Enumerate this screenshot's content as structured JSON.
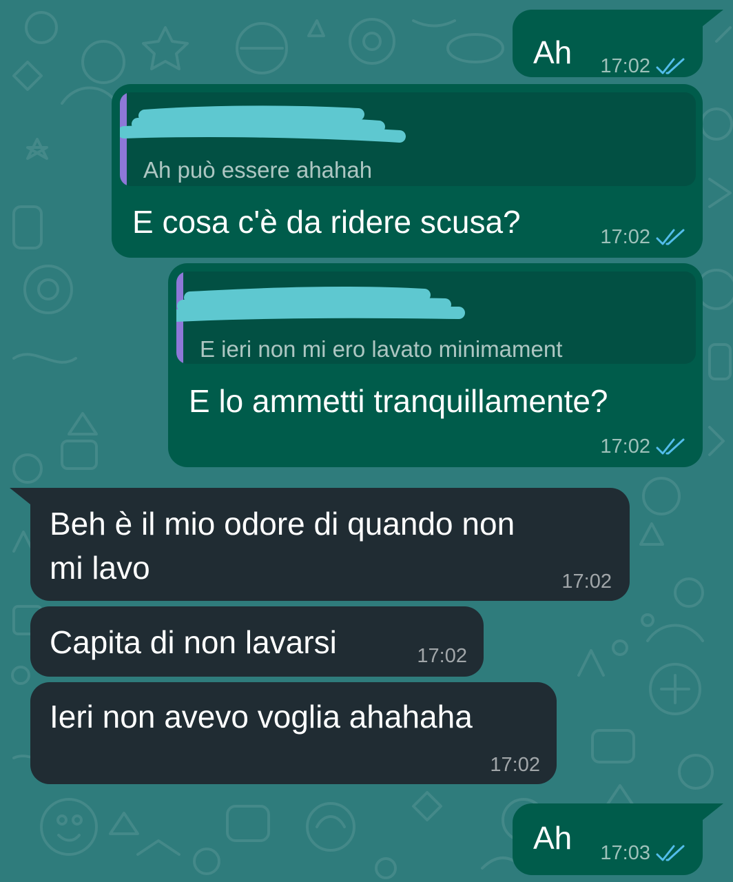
{
  "colors": {
    "wallpaper": "#2f7c7c",
    "outgoing_bubble": "#005c4b",
    "incoming_bubble": "#202c33",
    "quote_background": "#025043",
    "quote_bar": "#8e78d8",
    "redaction": "#5ec8d0",
    "read_ticks": "#53bdeb"
  },
  "messages": [
    {
      "direction": "outgoing",
      "text": "Ah",
      "time": "17:02",
      "status": "read-double-check-icon"
    },
    {
      "direction": "outgoing",
      "quote": {
        "author": "redacted",
        "text": "Ah può essere ahahah"
      },
      "text": "E cosa c'è da ridere scusa?",
      "time": "17:02",
      "status": "read-double-check-icon"
    },
    {
      "direction": "outgoing",
      "quote": {
        "author": "redacted",
        "text": "E ieri non mi ero lavato minimament"
      },
      "text": "E lo ammetti tranquillamente?",
      "time": "17:02",
      "status": "read-double-check-icon"
    },
    {
      "direction": "incoming",
      "lines": [
        "Beh è il mio odore di quando non",
        "mi lavo"
      ],
      "time": "17:02"
    },
    {
      "direction": "incoming",
      "text": "Capita di non lavarsi",
      "time": "17:02"
    },
    {
      "direction": "incoming",
      "text": "Ieri non avevo voglia ahahaha",
      "time": "17:02"
    },
    {
      "direction": "outgoing",
      "text": "Ah",
      "time": "17:03",
      "status": "read-double-check-icon"
    }
  ]
}
